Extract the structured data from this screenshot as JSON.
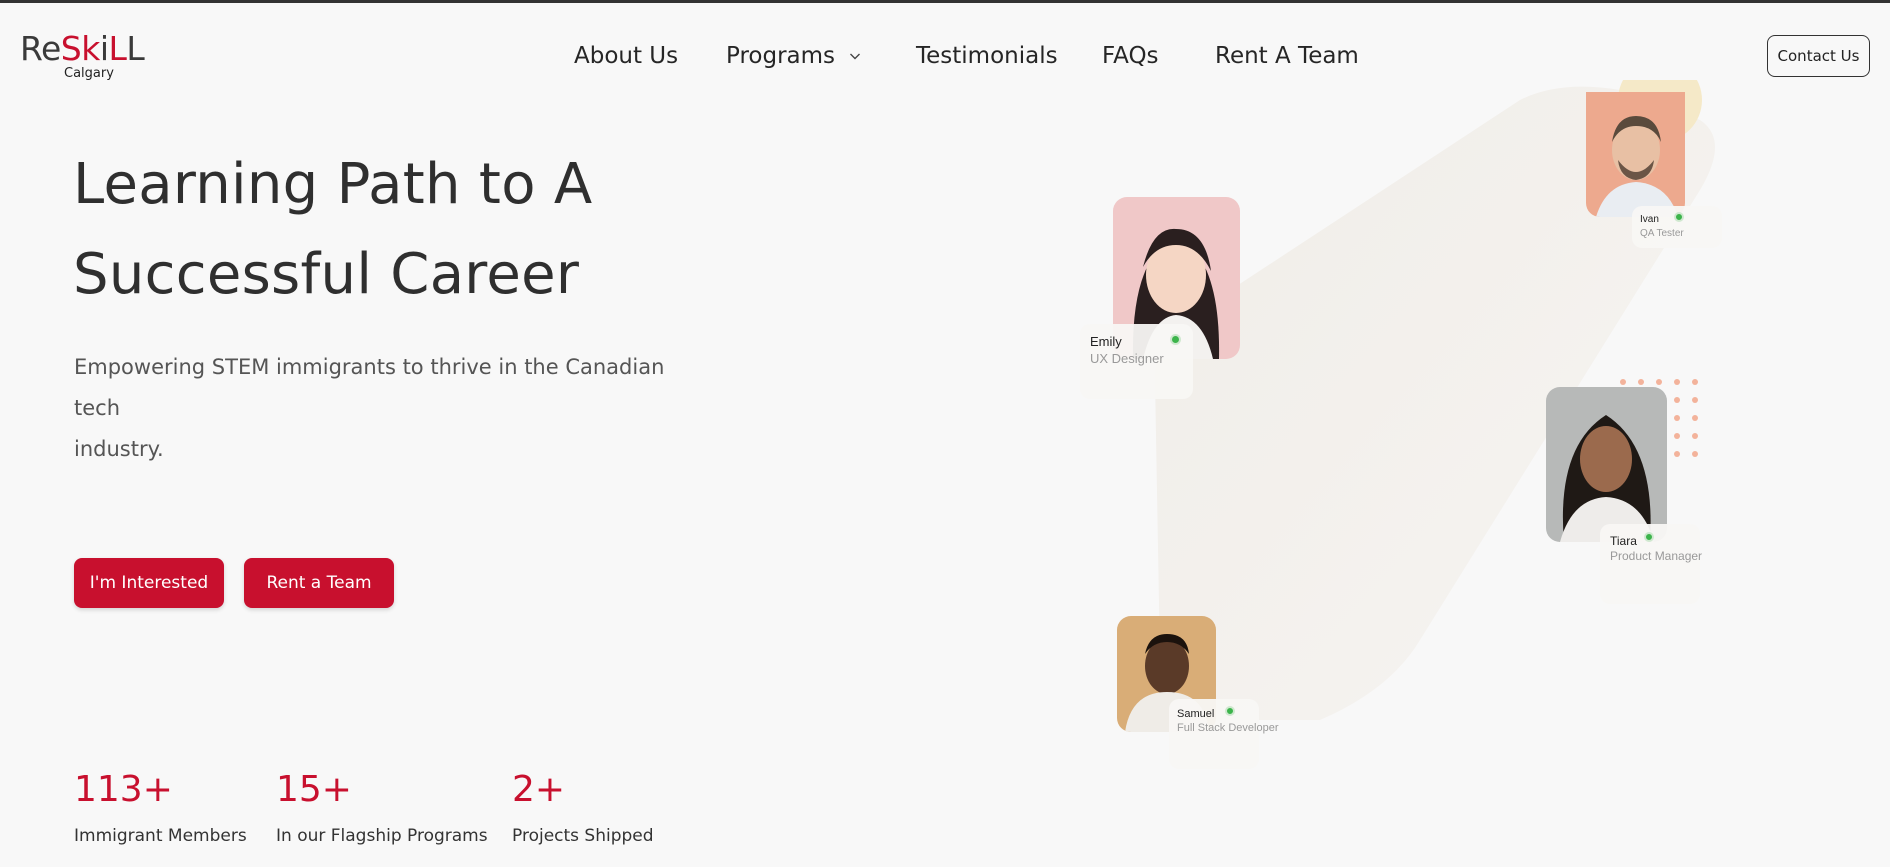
{
  "logo": {
    "word_black_1": "Re",
    "word_red": "Sk",
    "word_black_2": "i",
    "word_red_2": "L",
    "word_black_3": "L",
    "sub": "Calgary"
  },
  "nav": {
    "items": [
      {
        "label": "About Us"
      },
      {
        "label": "Programs"
      },
      {
        "label": "Testimonials"
      },
      {
        "label": "FAQs"
      },
      {
        "label": "Rent A Team"
      }
    ],
    "contact_label": "Contact Us"
  },
  "hero": {
    "title_line1": "Learning Path to A",
    "title_line2": "Successful Career",
    "subtitle_line1": "Empowering STEM immigrants to thrive in the Canadian tech",
    "subtitle_line2": "industry.",
    "cta_primary": "I'm Interested",
    "cta_secondary": "Rent a Team"
  },
  "stats": [
    {
      "value": "113+",
      "label": "Immigrant Members"
    },
    {
      "value": "15+",
      "label": "In our Flagship Programs"
    },
    {
      "value": "2+",
      "label": "Projects Shipped"
    }
  ],
  "team": [
    {
      "name": "Emily",
      "role": "UX Designer"
    },
    {
      "name": "Ivan",
      "role": "QA Tester"
    },
    {
      "name": "Tiara",
      "role": "Product Manager"
    },
    {
      "name": "Samuel",
      "role": "Full Stack Developer"
    }
  ],
  "colors": {
    "brand_red": "#c8102e",
    "status_online": "#3cb44b",
    "background": "#f8f8f8"
  }
}
